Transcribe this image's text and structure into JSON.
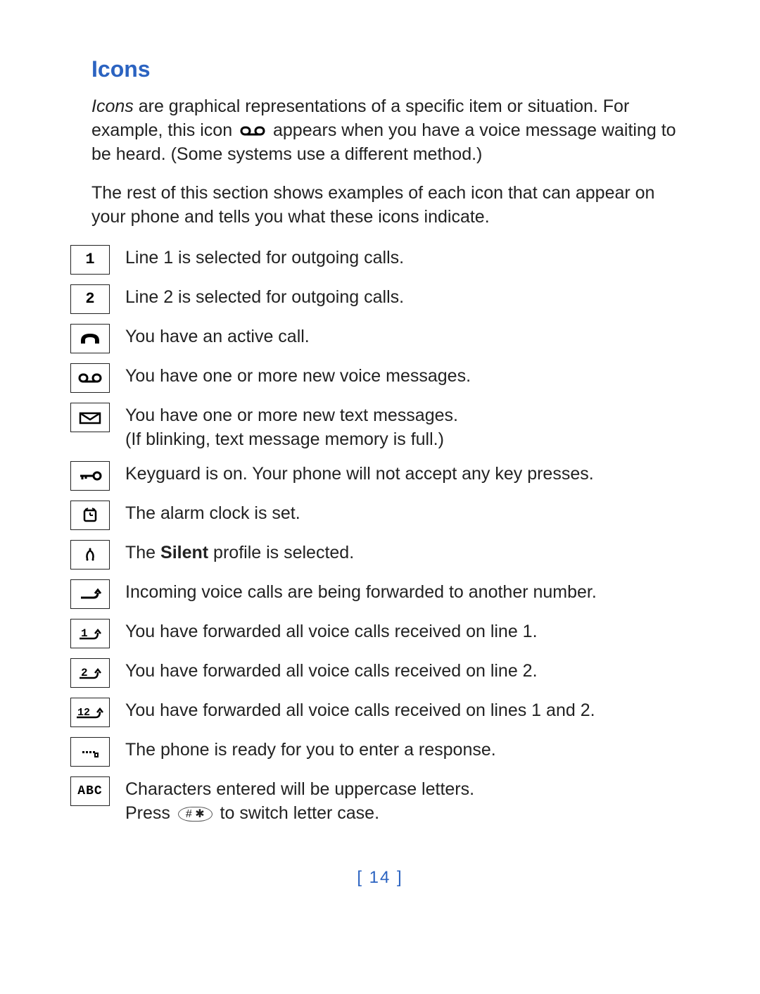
{
  "heading": "Icons",
  "intro": {
    "lead_italic": "Icons",
    "before_icon": " are graphical representations of a specific item or situation. For example, this icon ",
    "after_icon": " appears when you have a voice message waiting to be heard. (Some systems use a different method.)"
  },
  "intro2": "The rest of this section shows examples of each icon that can appear on your phone and tells you what these icons indicate.",
  "rows": [
    {
      "glyph": "1",
      "icon_name": "line-1-icon",
      "desc": "Line 1 is selected for outgoing calls."
    },
    {
      "glyph": "2",
      "icon_name": "line-2-icon",
      "desc": "Line 2 is selected for outgoing calls."
    },
    {
      "glyph": "handset",
      "icon_name": "active-call-icon",
      "desc": "You have an active call."
    },
    {
      "glyph": "tape",
      "icon_name": "voicemail-icon",
      "desc": "You have one or more new voice messages."
    },
    {
      "glyph": "envelope",
      "icon_name": "text-message-icon",
      "desc": "You have one or more new text messages.\n(If blinking, text message memory is full.)"
    },
    {
      "glyph": "key",
      "icon_name": "keyguard-icon",
      "desc": "Keyguard is on. Your phone will not accept any key presses."
    },
    {
      "glyph": "clock",
      "icon_name": "alarm-clock-icon",
      "desc": "The alarm clock is set."
    },
    {
      "glyph": "silent",
      "icon_name": "silent-profile-icon",
      "desc_pre": "The ",
      "bold": "Silent",
      "desc_post": " profile is selected."
    },
    {
      "glyph": "divert",
      "icon_name": "call-forward-icon",
      "desc": "Incoming voice calls are being forwarded to another number."
    },
    {
      "glyph": "1f",
      "icon_name": "forward-line-1-icon",
      "desc": "You have forwarded all voice calls received on line 1."
    },
    {
      "glyph": "2f",
      "icon_name": "forward-line-2-icon",
      "desc": "You have forwarded all voice calls received on line 2."
    },
    {
      "glyph": "12f",
      "icon_name": "forward-lines-1-2-icon",
      "desc": "You have forwarded all voice calls received on lines 1 and 2."
    },
    {
      "glyph": "dots",
      "icon_name": "enter-response-icon",
      "desc": "The phone is ready for you to enter a response."
    },
    {
      "glyph": "ABC",
      "icon_name": "uppercase-abc-icon",
      "desc_pre": "Characters entered will be uppercase letters.\nPress ",
      "key": "# ✱",
      "desc_post": " to switch letter case."
    }
  ],
  "page_number": "[ 14 ]"
}
